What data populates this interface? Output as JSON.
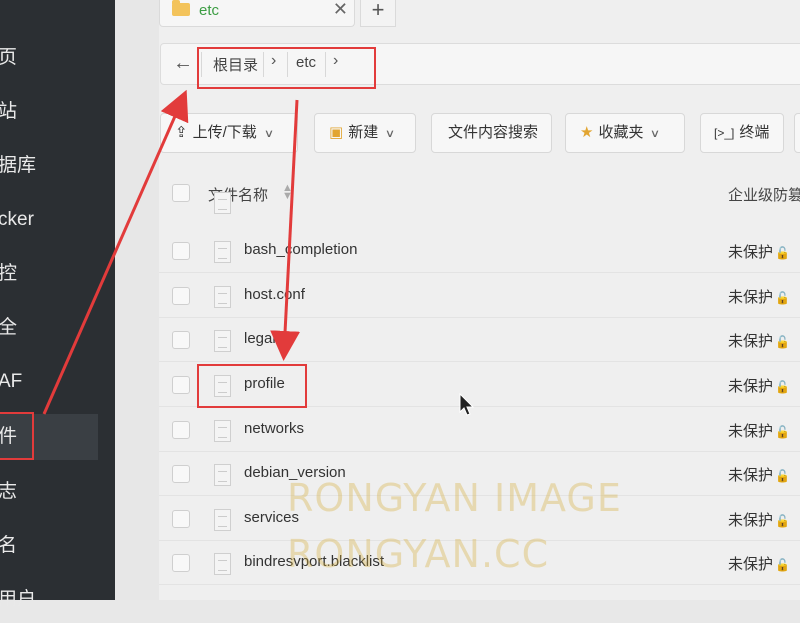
{
  "sidebar": {
    "items": [
      {
        "label": "页",
        "active": false
      },
      {
        "label": "站",
        "active": false
      },
      {
        "label": "据库",
        "active": false
      },
      {
        "label": "cker",
        "active": false
      },
      {
        "label": "控",
        "active": false
      },
      {
        "label": "全",
        "active": false
      },
      {
        "label": "AF",
        "active": false
      },
      {
        "label": "件",
        "active": true
      },
      {
        "label": "志",
        "active": false
      },
      {
        "label": "名",
        "active": false
      },
      {
        "label": "用户",
        "active": false
      }
    ]
  },
  "tabs": [
    {
      "label": "etc",
      "close": "✕"
    }
  ],
  "new_tab": "+",
  "path": {
    "back_icon": "back-arrow-icon",
    "crumbs": [
      "根目录",
      "etc"
    ],
    "separator": "›"
  },
  "toolbar": {
    "upload": "上传/下载",
    "new": "新建",
    "search": "文件内容搜索",
    "favorites": "收藏夹",
    "terminal": "终端"
  },
  "table": {
    "col_name": "文件名称",
    "col_protect": "企业级防篡",
    "rows": [
      {
        "name": "bash_completion",
        "protect": "未保护"
      },
      {
        "name": "host.conf",
        "protect": "未保护"
      },
      {
        "name": "legal",
        "protect": "未保护"
      },
      {
        "name": "profile",
        "protect": "未保护"
      },
      {
        "name": "networks",
        "protect": "未保护"
      },
      {
        "name": "debian_version",
        "protect": "未保护"
      },
      {
        "name": "services",
        "protect": "未保护"
      },
      {
        "name": "bindresvport.blacklist",
        "protect": "未保护"
      }
    ]
  },
  "watermark": {
    "line1": "RONGYAN IMAGE",
    "line2": "RONGYAN.CC"
  },
  "colors": {
    "annotation_red": "#e23b3b",
    "active_tab_text": "#3c9d43",
    "folder": "#f3c35b"
  }
}
